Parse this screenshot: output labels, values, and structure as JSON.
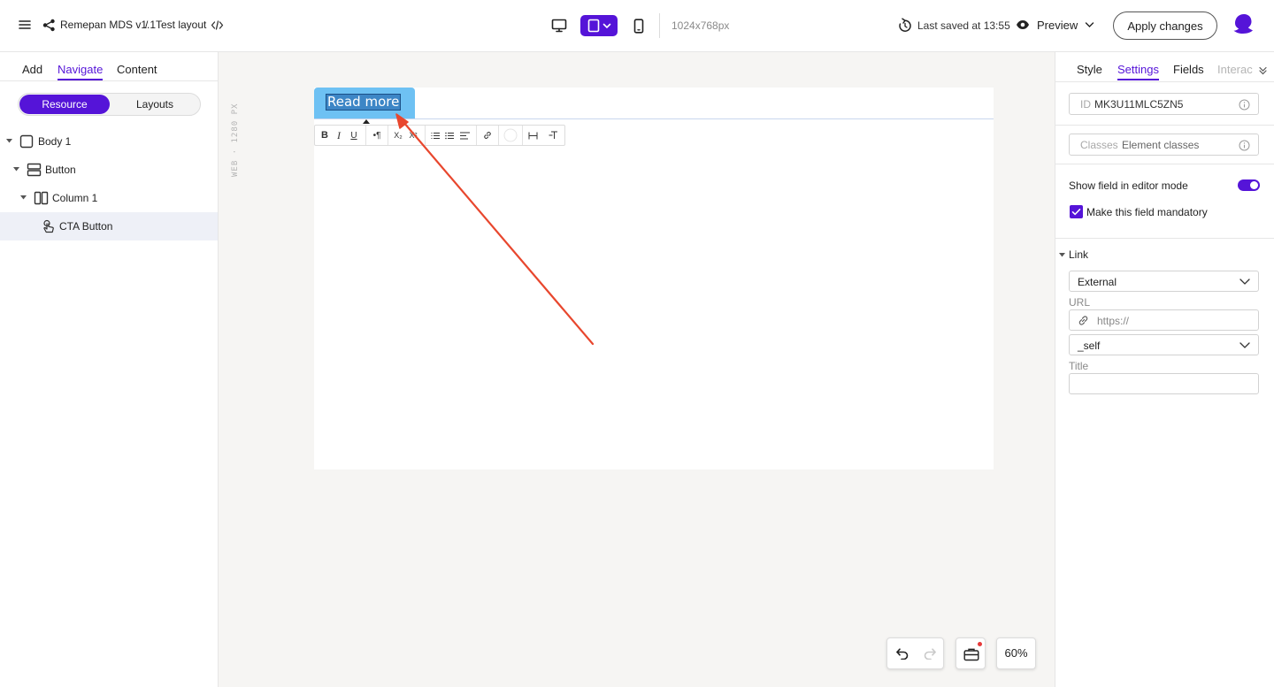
{
  "header": {
    "project": "Remepan MDS v1.1",
    "separator": "/",
    "layout_name": "Test layout",
    "dimensions": "1024x768px",
    "saved_status": "Last saved at 13:55",
    "preview_label": "Preview",
    "apply_label": "Apply changes",
    "accent_color": "#5514d8"
  },
  "left_panel": {
    "tabs": [
      {
        "label": "Add"
      },
      {
        "label": "Navigate",
        "active": true
      },
      {
        "label": "Content"
      }
    ],
    "segments": [
      {
        "label": "Resource",
        "active": true
      },
      {
        "label": "Layouts"
      }
    ],
    "tree": [
      {
        "label": "Body 1",
        "icon": "square-icon"
      },
      {
        "label": "Button",
        "icon": "rows-icon"
      },
      {
        "label": "Column 1",
        "icon": "columns-icon"
      },
      {
        "label": "CTA Button",
        "icon": "pointer-hand-icon",
        "selected": true
      }
    ]
  },
  "canvas": {
    "viewport_tag": "WEB · 1280 PX",
    "button_text": "Read more",
    "button_color": "#6ec1f3",
    "zoom": "60%",
    "annotation_arrow_color": "#e8472e"
  },
  "right_panel": {
    "tabs": [
      {
        "label": "Style"
      },
      {
        "label": "Settings",
        "active": true
      },
      {
        "label": "Fields"
      },
      {
        "label": "Interac"
      }
    ],
    "id_key": "ID",
    "id_value": "MK3U11MLC5ZN5",
    "classes_key": "Classes",
    "classes_placeholder": "Element classes",
    "show_field_label": "Show field in editor mode",
    "show_field_on": true,
    "mandatory_label": "Make this field mandatory",
    "mandatory_checked": true,
    "link_section": "Link",
    "link_type": "External",
    "url_label": "URL",
    "url_placeholder": "https://",
    "target": "_self",
    "title_label": "Title",
    "title_value": ""
  }
}
